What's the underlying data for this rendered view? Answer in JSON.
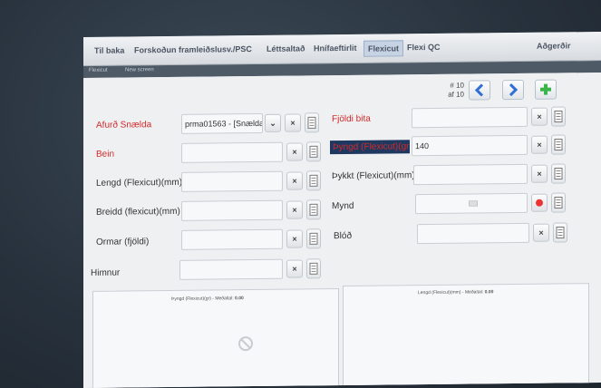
{
  "tabs": [
    {
      "label": "Til baka"
    },
    {
      "label": "Forskoðun framleiðslusv./PSC"
    },
    {
      "label": "Léttsaltað"
    },
    {
      "label": "Hnífaeftirlit"
    },
    {
      "label": "Flexicut"
    },
    {
      "label": "Flexi QC"
    },
    {
      "label": "Aðgerðir"
    }
  ],
  "breadcrumb": {
    "item1": "Flexicut",
    "item2": "New screen"
  },
  "record": {
    "current": "# 10",
    "total": "af 10"
  },
  "form": {
    "afurd_label": "Afurð Snælda",
    "afurd_value": "prma01563 - [Snælda",
    "bein_label": "Bein",
    "lengd_label": "Lengd (Flexicut)(mm)",
    "breidd_label": "Breidd (flexicut)(mm)",
    "ormar_label": "Ormar (fjöldi)",
    "himnur_label": "Himnur",
    "fjoldi_label": "Fjöldi bita",
    "thyngd_label": "Þyngd (Flexicut)(gr)",
    "thyngd_value": "140",
    "thykkt_label": "Þykkt (Flexicut)(mm)",
    "mynd_label": "Mynd",
    "blod_label": "Blóð"
  },
  "buttons": {
    "clear": "×",
    "dropdown": "⌄"
  },
  "charts": [
    {
      "title": "Þyngd (Flexicut)(gr) - Meðaltal:",
      "value": "0.00"
    },
    {
      "title": "Lengd (Flexicut)(mm) - Meðaltal:",
      "value": "0.00"
    }
  ],
  "colors": {
    "required": "#d22a2a",
    "highlight": "#1f3860",
    "nav_arrow": "#2f6fd6",
    "add": "#3bb54a"
  }
}
